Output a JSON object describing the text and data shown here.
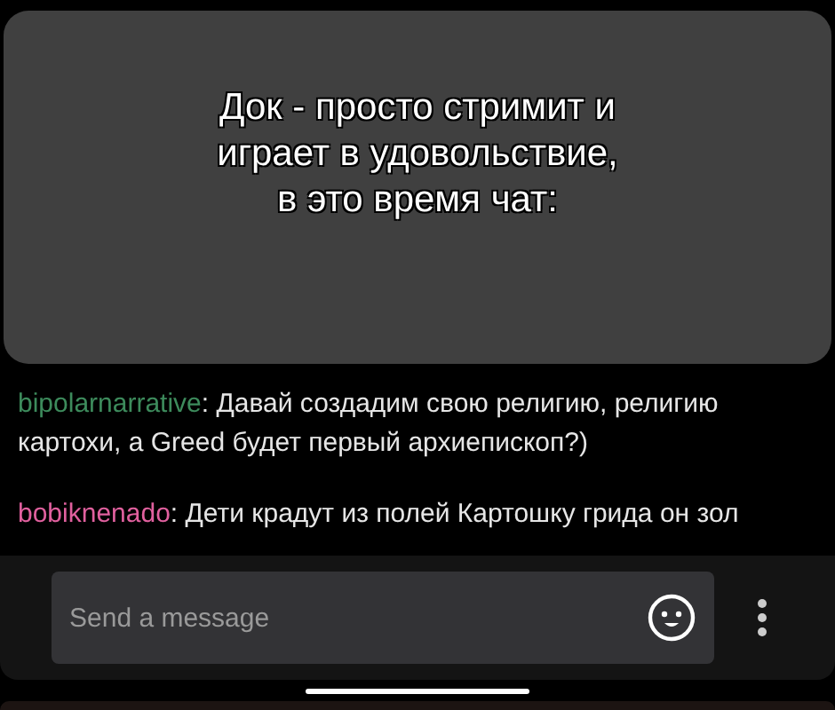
{
  "caption": {
    "lines": [
      "Док - просто стримит и",
      "играет в удовольствие,",
      "в это время чат:"
    ]
  },
  "messages": [
    {
      "user": "bipolarnarrative",
      "separator": ":",
      "color": "#3d8b5c",
      "text": "Давай создадим свою религию, религию картохи, а Greed будет первый архиепископ?)"
    },
    {
      "user": "bobiknenado",
      "separator": ":",
      "color": "#e0609e",
      "text": "Дети крадут из полей Картошку грида он зол"
    }
  ],
  "composer": {
    "placeholder": "Send a message"
  }
}
